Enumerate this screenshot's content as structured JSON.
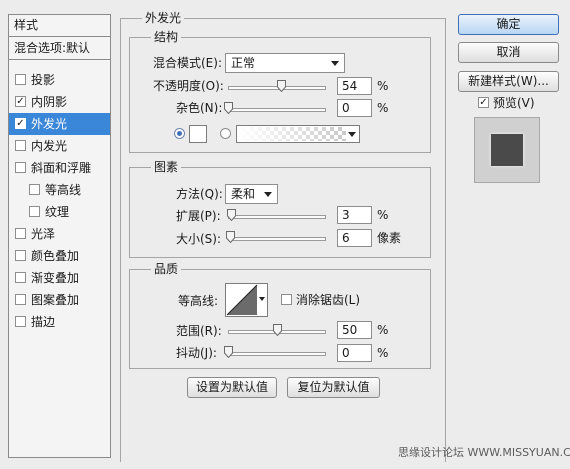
{
  "sidebar": {
    "header": "样式",
    "subheader": "混合选项:默认",
    "items": [
      {
        "label": "投影",
        "checked": false
      },
      {
        "label": "内阴影",
        "checked": true
      },
      {
        "label": "外发光",
        "checked": true,
        "selected": true
      },
      {
        "label": "内发光",
        "checked": false
      },
      {
        "label": "斜面和浮雕",
        "checked": false
      },
      {
        "label": "等高线",
        "checked": false,
        "indent": true
      },
      {
        "label": "纹理",
        "checked": false,
        "indent": true
      },
      {
        "label": "光泽",
        "checked": false
      },
      {
        "label": "颜色叠加",
        "checked": false
      },
      {
        "label": "渐变叠加",
        "checked": false
      },
      {
        "label": "图案叠加",
        "checked": false
      },
      {
        "label": "描边",
        "checked": false
      }
    ]
  },
  "panel": {
    "title": "外发光",
    "structure": {
      "title": "结构",
      "blend_mode_label": "混合模式(E):",
      "blend_mode_value": "正常",
      "opacity_label": "不透明度(O):",
      "opacity_value": "54",
      "opacity_unit": "%",
      "opacity_fraction": 0.54,
      "noise_label": "杂色(N):",
      "noise_value": "0",
      "noise_unit": "%",
      "noise_fraction": 0,
      "glow_color": "#ffffff"
    },
    "elements": {
      "title": "图素",
      "technique_label": "方法(Q):",
      "technique_value": "柔和",
      "spread_label": "扩展(P):",
      "spread_value": "3",
      "spread_unit": "%",
      "spread_fraction": 0.03,
      "size_label": "大小(S):",
      "size_value": "6",
      "size_unit": "像素",
      "size_fraction": 0.024
    },
    "quality": {
      "title": "品质",
      "contour_label": "等高线:",
      "antialias_label": "消除锯齿(L)",
      "antialias_checked": false,
      "range_label": "范围(R):",
      "range_value": "50",
      "range_unit": "%",
      "range_fraction": 0.5,
      "jitter_label": "抖动(J):",
      "jitter_value": "0",
      "jitter_unit": "%",
      "jitter_fraction": 0
    },
    "buttons": {
      "make_default": "设置为默认值",
      "reset_default": "复位为默认值"
    }
  },
  "right": {
    "ok": "确定",
    "cancel": "取消",
    "new_style": "新建样式(W)...",
    "preview_label": "预览(V)",
    "preview_checked": true
  },
  "watermark": "思缘设计论坛 WWW.MISSYUAN.COM",
  "colors": {
    "selection": "#3a86d8",
    "accent": "#3f6fb6"
  }
}
